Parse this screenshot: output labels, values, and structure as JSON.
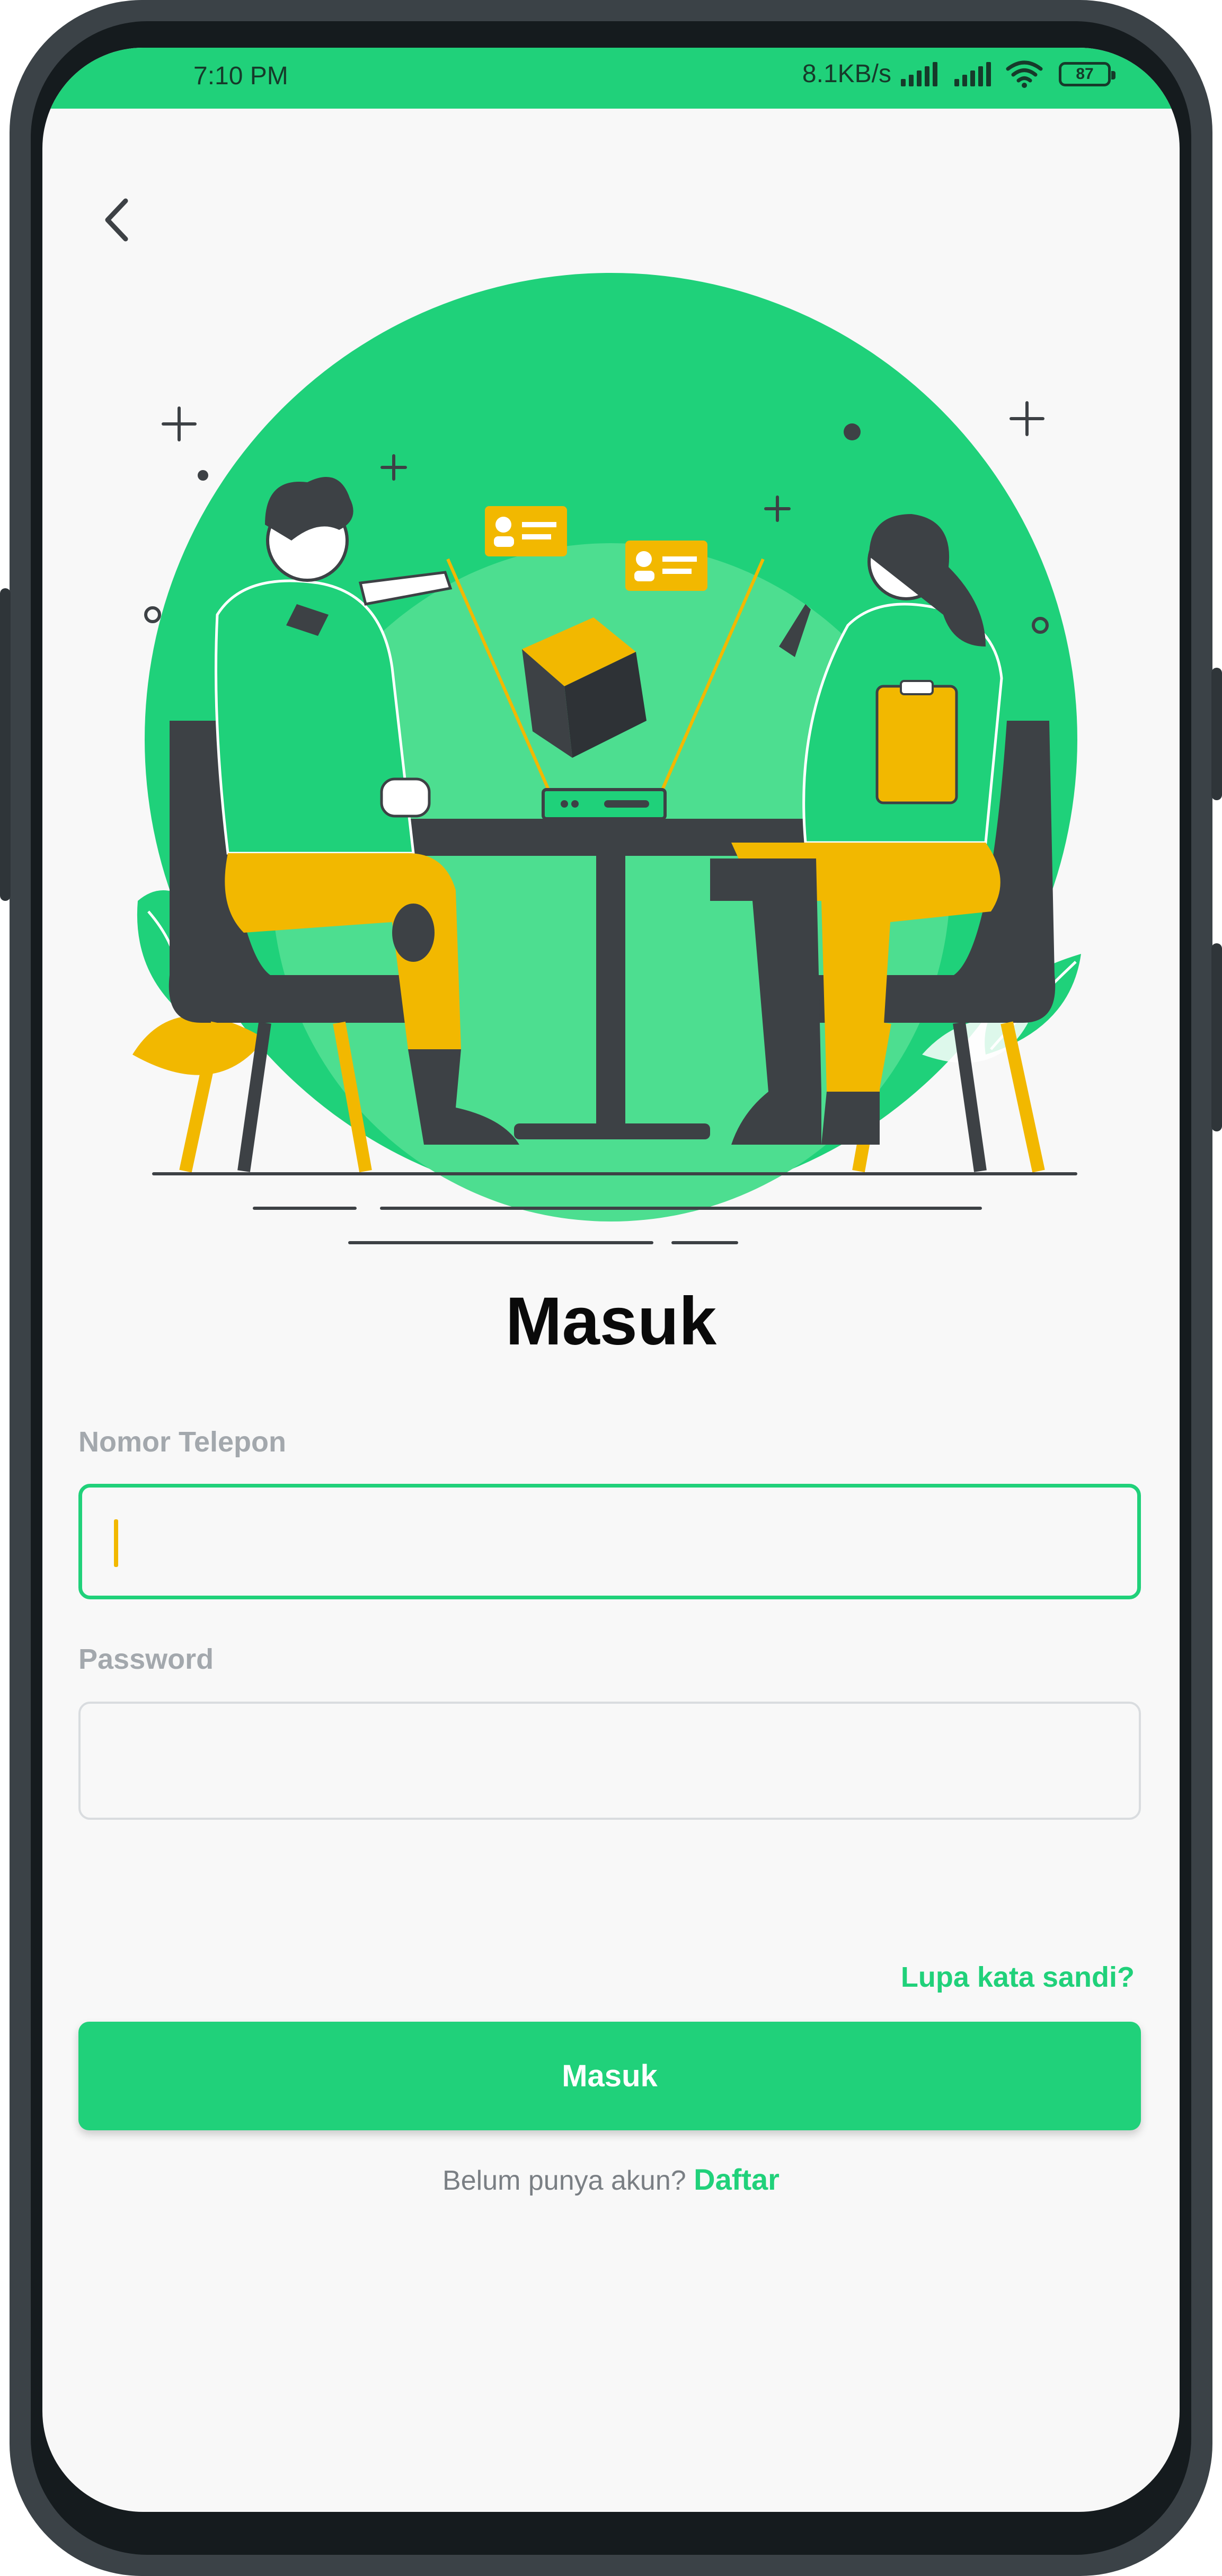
{
  "status_bar": {
    "time": "7:10 PM",
    "network_speed": "8.1KB/s",
    "battery": "87",
    "icons": [
      "signal-icon",
      "signal-icon",
      "wifi-icon",
      "battery-icon"
    ]
  },
  "header": {
    "back_icon": "back-arrow-icon"
  },
  "illustration": {
    "name": "two-people-meeting-illustration"
  },
  "form": {
    "title": "Masuk",
    "phone_label": "Nomor Telepon",
    "phone_value": "",
    "password_label": "Password",
    "password_value": "",
    "forgot_label": "Lupa kata sandi?",
    "submit_label": "Masuk",
    "signup_prompt": "Belum punya akun?",
    "signup_link": "Daftar"
  },
  "colors": {
    "primary": "#20d17a",
    "accent": "#f2b800",
    "dark": "#3d4145"
  }
}
